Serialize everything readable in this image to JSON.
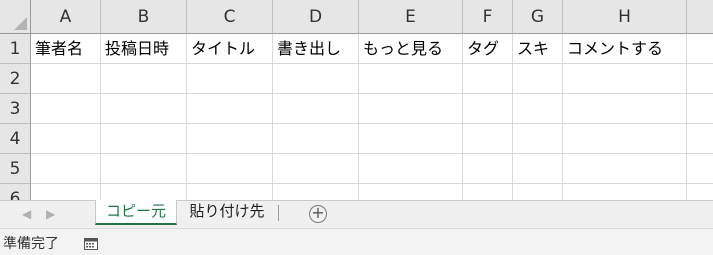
{
  "columns": [
    "A",
    "B",
    "C",
    "D",
    "E",
    "F",
    "G",
    "H"
  ],
  "rows": [
    "1",
    "2",
    "3",
    "4",
    "5",
    "6"
  ],
  "row1": [
    "筆者名",
    "投稿日時",
    "タイトル",
    "書き出し",
    "もっと見る",
    "タグ",
    "スキ",
    "コメントする"
  ],
  "sheet_tabs": [
    "コピー元",
    "貼り付け先"
  ],
  "add_sheet": "+",
  "nav": {
    "prev": "◀",
    "next": "▶"
  },
  "status": {
    "ready": "準備完了"
  },
  "colors": {
    "accent": "#217346",
    "header_bg": "#e6e6e6"
  },
  "icons": {
    "macro": "macro-record-icon",
    "add": "add-sheet-icon"
  }
}
